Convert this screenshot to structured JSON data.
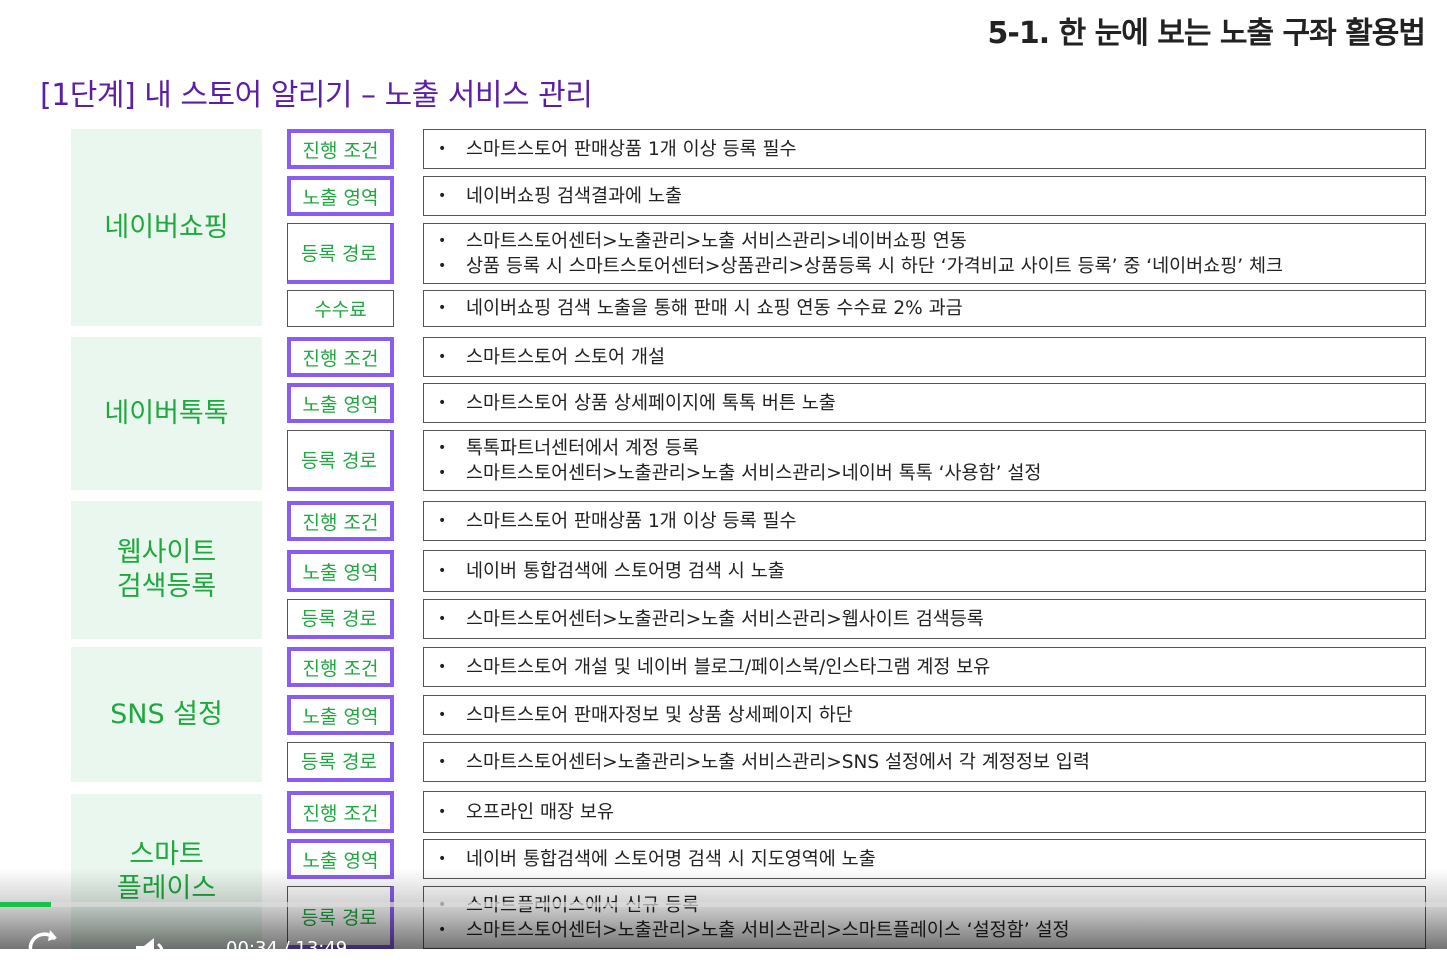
{
  "slide": {
    "title": "5-1. 한 눈에 보는 노출 구좌 활용법",
    "section_title": "[1단계] 내 스토어 알리기 – 노출 서비스 관리"
  },
  "groups": [
    {
      "category": "네이버쇼핑",
      "rows": [
        {
          "tag": "진행 조건",
          "items": [
            "스마트스토어 판매상품 1개 이상 등록 필수"
          ]
        },
        {
          "tag": "노출 영역",
          "items": [
            "네이버쇼핑 검색결과에 노출"
          ]
        },
        {
          "tag": "등록 경로",
          "items": [
            "스마트스토어센터>노출관리>노출 서비스관리>네이버쇼핑 연동",
            "상품 등록 시 스마트스토어센터>상품관리>상품등록 시 하단 ‘가격비교 사이트 등록’ 중 ‘네이버쇼핑’ 체크"
          ]
        },
        {
          "tag": "수수료",
          "items": [
            "네이버쇼핑 검색 노출을 통해 판매 시 쇼핑 연동 수수료 2% 과금"
          ]
        }
      ]
    },
    {
      "category": "네이버톡톡",
      "rows": [
        {
          "tag": "진행 조건",
          "items": [
            "스마트스토어 스토어 개설"
          ]
        },
        {
          "tag": "노출 영역",
          "items": [
            "스마트스토어 상품 상세페이지에 톡톡 버튼 노출"
          ]
        },
        {
          "tag": "등록 경로",
          "items": [
            "톡톡파트너센터에서 계정 등록",
            "스마트스토어센터>노출관리>노출 서비스관리>네이버 톡톡 ‘사용함’ 설정"
          ]
        }
      ]
    },
    {
      "category": "웹사이트\n검색등록",
      "rows": [
        {
          "tag": "진행 조건",
          "items": [
            "스마트스토어 판매상품 1개 이상 등록 필수"
          ]
        },
        {
          "tag": "노출 영역",
          "items": [
            "네이버 통합검색에 스토어명 검색 시 노출"
          ]
        },
        {
          "tag": "등록 경로",
          "items": [
            "스마트스토어센터>노출관리>노출 서비스관리>웹사이트 검색등록"
          ]
        }
      ]
    },
    {
      "category": "SNS 설정",
      "rows": [
        {
          "tag": "진행 조건",
          "items": [
            "스마트스토어 개설 및 네이버 블로그/페이스북/인스타그램 계정 보유"
          ]
        },
        {
          "tag": "노출 영역",
          "items": [
            "스마트스토어 판매자정보 및 상품 상세페이지 하단"
          ]
        },
        {
          "tag": "등록 경로",
          "items": [
            "스마트스토어센터>노출관리>노출 서비스관리>SNS 설정에서 각 계정정보 입력"
          ]
        }
      ]
    },
    {
      "category": "스마트\n플레이스",
      "rows": [
        {
          "tag": "진행 조건",
          "items": [
            "오프라인 매장 보유"
          ]
        },
        {
          "tag": "노출 영역",
          "items": [
            "네이버 통합검색에 스토어명 검색 시 지도영역에 노출"
          ]
        },
        {
          "tag": "등록 경로",
          "items": [
            "스마트플레이스에서 신규 등록",
            "스마트스토어센터>노출관리>노출 서비스관리>스마트플레이스 ‘설정함’ 설정"
          ]
        }
      ]
    }
  ],
  "player": {
    "progress": 0.035,
    "time_text": "00:34 / 13:49",
    "icons": [
      "replay-icon",
      "volume-icon"
    ]
  }
}
